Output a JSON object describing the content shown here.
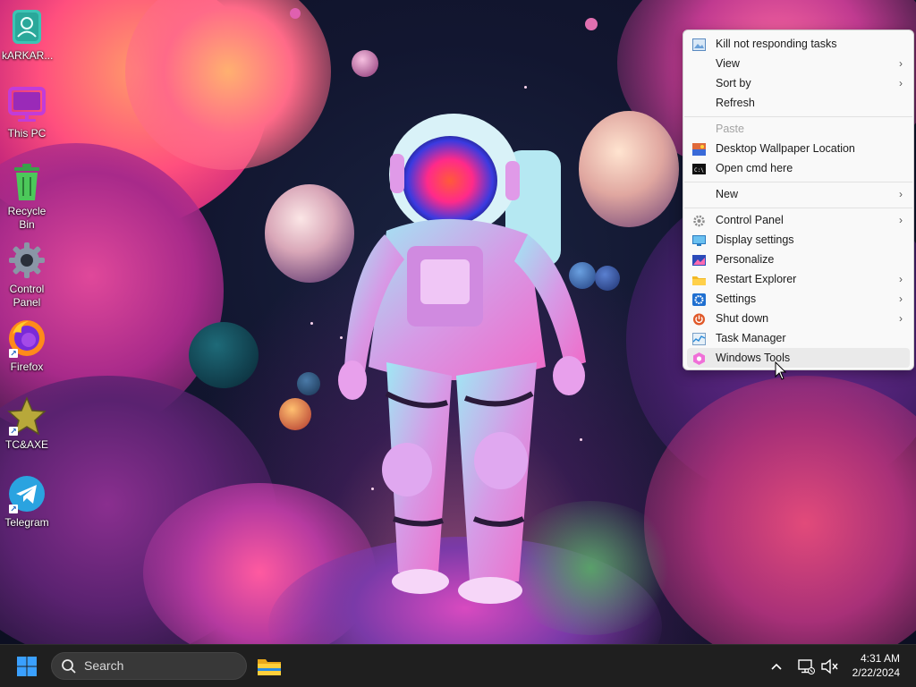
{
  "desktop": {
    "icons": [
      {
        "label": "kARKAR...",
        "icon": "user-folder-icon"
      },
      {
        "label": "This PC",
        "icon": "monitor-icon"
      },
      {
        "label": "Recycle Bin",
        "icon": "recycle-bin-icon"
      },
      {
        "label": "Control Panel",
        "icon": "gear-icon"
      },
      {
        "label": "Firefox",
        "icon": "firefox-icon"
      },
      {
        "label": "TC&AXE",
        "icon": "star-icon"
      },
      {
        "label": "Telegram",
        "icon": "telegram-icon"
      }
    ]
  },
  "context_menu": {
    "items": [
      {
        "label": "Kill not responding tasks",
        "icon": "image-icon",
        "submenu": false,
        "disabled": false
      },
      {
        "label": "View",
        "submenu": true,
        "disabled": false
      },
      {
        "label": "Sort by",
        "submenu": true,
        "disabled": false
      },
      {
        "label": "Refresh",
        "submenu": false,
        "disabled": false
      },
      {
        "label": "Paste",
        "submenu": false,
        "disabled": true
      },
      {
        "label": "Desktop Wallpaper Location",
        "icon": "wallpaper-icon",
        "submenu": false,
        "disabled": false
      },
      {
        "label": "Open cmd here",
        "icon": "cmd-icon",
        "submenu": false,
        "disabled": false
      },
      {
        "label": "New",
        "submenu": true,
        "disabled": false
      },
      {
        "label": "Control Panel",
        "icon": "gear-icon",
        "submenu": true,
        "disabled": false
      },
      {
        "label": "Display settings",
        "icon": "display-icon",
        "submenu": false,
        "disabled": false
      },
      {
        "label": "Personalize",
        "icon": "personalize-icon",
        "submenu": false,
        "disabled": false
      },
      {
        "label": "Restart Explorer",
        "icon": "folder-icon",
        "submenu": true,
        "disabled": false
      },
      {
        "label": "Settings",
        "icon": "settings-icon",
        "submenu": true,
        "disabled": false
      },
      {
        "label": "Shut down",
        "icon": "power-icon",
        "submenu": true,
        "disabled": false
      },
      {
        "label": "Task Manager",
        "icon": "task-manager-icon",
        "submenu": false,
        "disabled": false
      },
      {
        "label": "Windows Tools",
        "icon": "windows-tools-icon",
        "submenu": false,
        "disabled": false,
        "hovered": true
      }
    ],
    "arrow": "›"
  },
  "taskbar": {
    "search_placeholder": "Search",
    "time": "4:31 AM",
    "date": "2/22/2024",
    "tray_chevron": "^"
  },
  "colors": {
    "taskbar_bg": "#1f1f1f",
    "menu_bg": "#f9f9f9",
    "menu_hover": "#eaeaea",
    "start_blue": "#3aa0ff"
  }
}
